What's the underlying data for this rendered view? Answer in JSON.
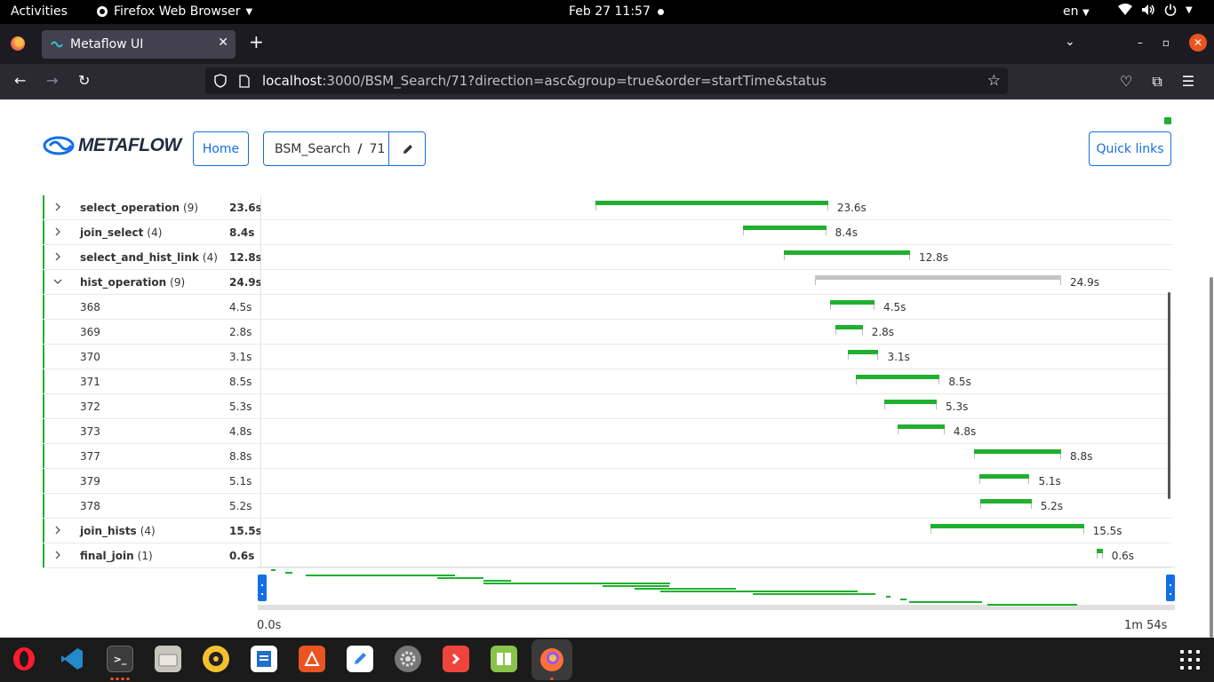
{
  "topbar": {
    "activities": "Activities",
    "app_name": "Firefox Web Browser",
    "clock": "Feb 27  11:57",
    "lang": "en"
  },
  "browser": {
    "tab_title": "Metaflow UI",
    "url_host": "localhost",
    "url_rest": ":3000/BSM_Search/71?direction=asc&group=true&order=startTime&status"
  },
  "header": {
    "logo_text": "METAFLOW",
    "home_label": "Home",
    "flow_name": "BSM_Search",
    "separator": "/",
    "run_id": "71",
    "quick_links_label": "Quick links"
  },
  "timeline": {
    "rows": [
      {
        "name": "select_operation",
        "count": "(9)",
        "duration": "23.6s",
        "label": "23.6s",
        "expanded": false,
        "start_s": 27.6,
        "end_s": 51.2
      },
      {
        "name": "join_select",
        "count": "(4)",
        "duration": "8.4s",
        "label": "8.4s",
        "expanded": false,
        "start_s": 42.6,
        "end_s": 51.0
      },
      {
        "name": "select_and_hist_link",
        "count": "(4)",
        "duration": "12.8s",
        "label": "12.8s",
        "expanded": false,
        "start_s": 46.7,
        "end_s": 59.5
      },
      {
        "name": "hist_operation",
        "count": "(9)",
        "duration": "24.9s",
        "label": "24.9s",
        "expanded": true,
        "start_s": 49.9,
        "end_s": 74.8
      },
      {
        "name": "368",
        "duration": "4.5s",
        "label": "4.5s",
        "start_s": 51.4,
        "end_s": 55.9
      },
      {
        "name": "369",
        "duration": "2.8s",
        "label": "2.8s",
        "start_s": 51.9,
        "end_s": 54.7
      },
      {
        "name": "370",
        "duration": "3.1s",
        "label": "3.1s",
        "start_s": 53.2,
        "end_s": 56.3
      },
      {
        "name": "371",
        "duration": "8.5s",
        "label": "8.5s",
        "start_s": 54.0,
        "end_s": 62.5
      },
      {
        "name": "372",
        "duration": "5.3s",
        "label": "5.3s",
        "start_s": 56.9,
        "end_s": 62.2
      },
      {
        "name": "373",
        "duration": "4.8s",
        "label": "4.8s",
        "start_s": 58.2,
        "end_s": 63.0
      },
      {
        "name": "377",
        "duration": "8.8s",
        "label": "8.8s",
        "start_s": 66.0,
        "end_s": 74.8
      },
      {
        "name": "379",
        "duration": "5.1s",
        "label": "5.1s",
        "start_s": 66.5,
        "end_s": 71.6
      },
      {
        "name": "378",
        "duration": "5.2s",
        "label": "5.2s",
        "start_s": 66.6,
        "end_s": 71.8
      },
      {
        "name": "join_hists",
        "count": "(4)",
        "duration": "15.5s",
        "label": "15.5s",
        "expanded": false,
        "start_s": 61.6,
        "end_s": 77.1
      },
      {
        "name": "final_join",
        "count": "(1)",
        "duration": "0.6s",
        "label": "0.6s",
        "expanded": false,
        "start_s": 78.4,
        "end_s": 79.0
      }
    ],
    "axis_start": "0.0s",
    "axis_end": "1m 54s"
  },
  "colors": {
    "accent": "#146ee6",
    "success": "#20af2e",
    "grey_bar": "#c4c4c4"
  },
  "dock": [
    "opera",
    "vscode",
    "terminal",
    "files",
    "rhythmbox",
    "libreoffice-writer",
    "app-center",
    "text-editor",
    "settings",
    "anydesk",
    "diff-tool",
    "firefox"
  ]
}
